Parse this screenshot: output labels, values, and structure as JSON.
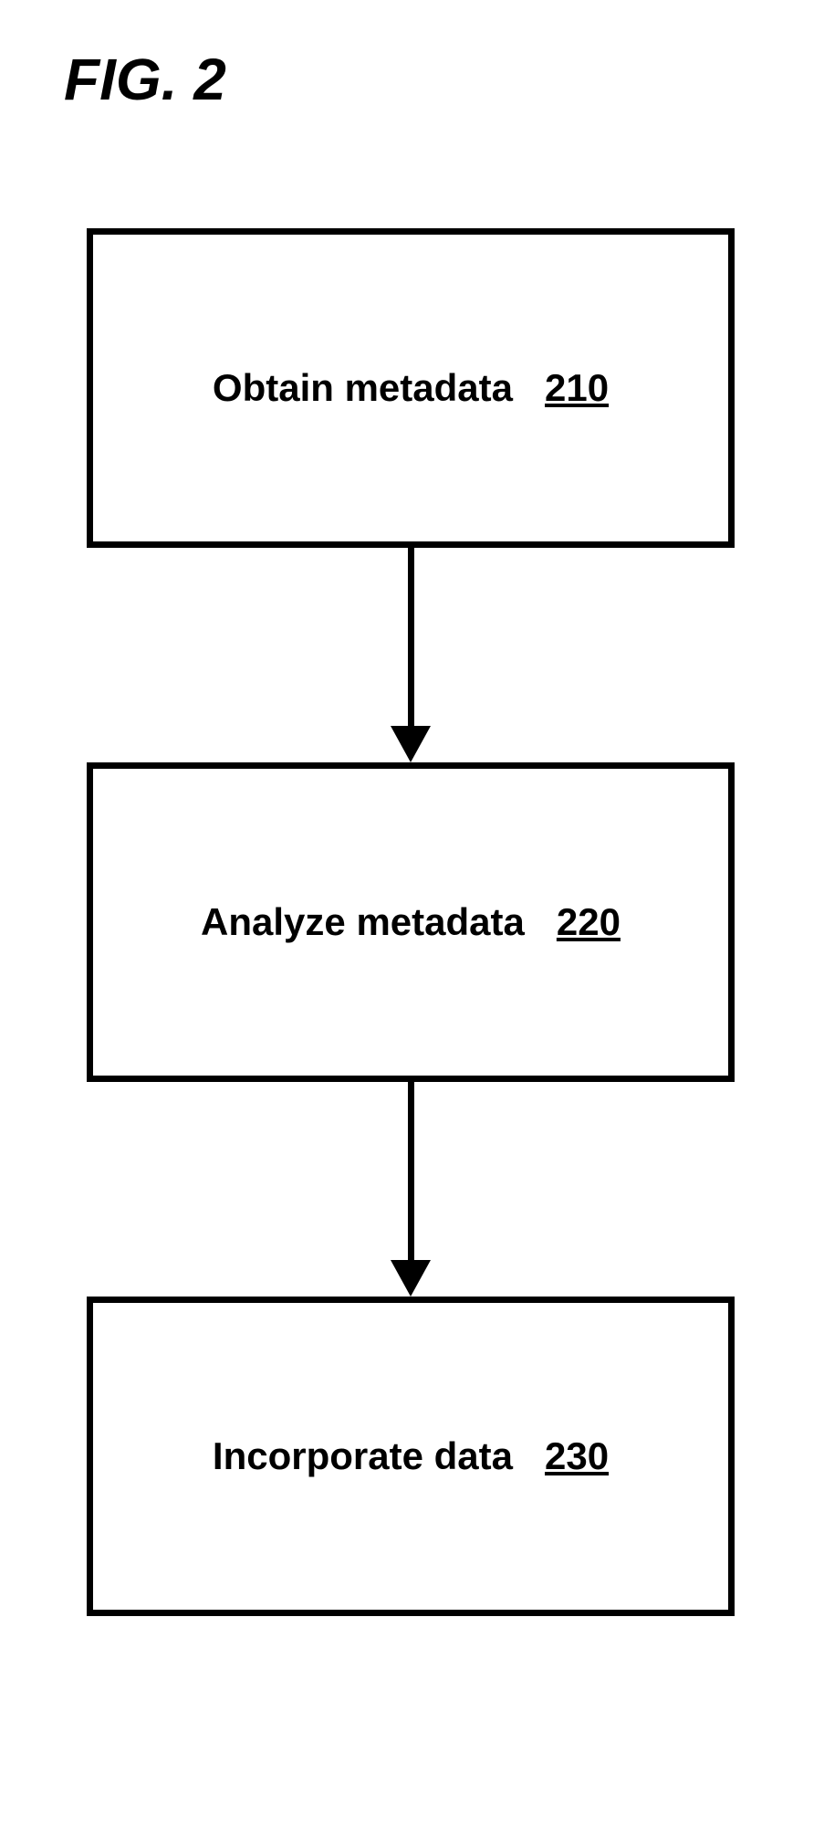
{
  "figure": {
    "title": "FIG. 2"
  },
  "boxes": [
    {
      "label": "Obtain metadata",
      "num": "210"
    },
    {
      "label": "Analyze metadata",
      "num": "220"
    },
    {
      "label": "Incorporate data",
      "num": "230"
    }
  ]
}
